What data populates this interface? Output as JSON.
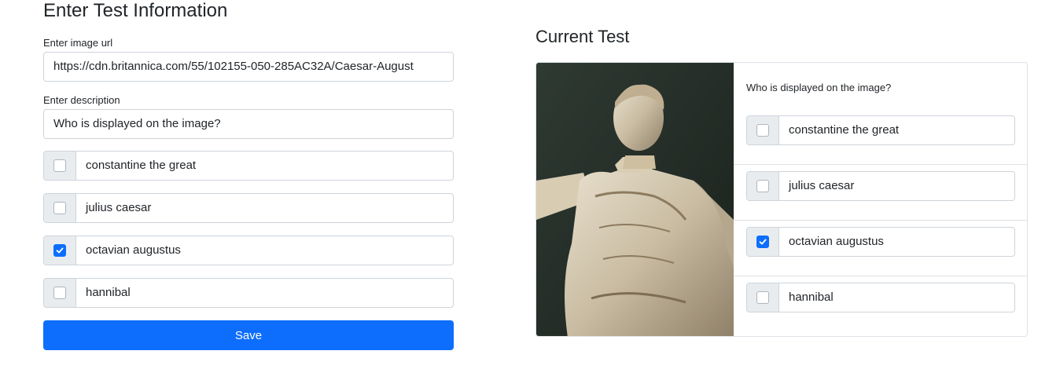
{
  "form": {
    "title": "Enter Test Information",
    "image_url_label": "Enter image url",
    "image_url_value": "https://cdn.britannica.com/55/102155-050-285AC32A/Caesar-August",
    "description_label": "Enter description",
    "description_value": "Who is displayed on the image?",
    "options": [
      {
        "label": "constantine the great",
        "checked": false
      },
      {
        "label": "julius caesar",
        "checked": false
      },
      {
        "label": "octavian augustus",
        "checked": true
      },
      {
        "label": "hannibal",
        "checked": false
      }
    ],
    "save_label": "Save"
  },
  "preview": {
    "title": "Current Test",
    "question": "Who is displayed on the image?",
    "options": [
      {
        "label": "constantine the great",
        "checked": false
      },
      {
        "label": "julius caesar",
        "checked": false
      },
      {
        "label": "octavian augustus",
        "checked": true
      },
      {
        "label": "hannibal",
        "checked": false
      }
    ]
  },
  "colors": {
    "accent": "#0d6efd",
    "border": "#ced4da",
    "addon_bg": "#e9ecef"
  }
}
